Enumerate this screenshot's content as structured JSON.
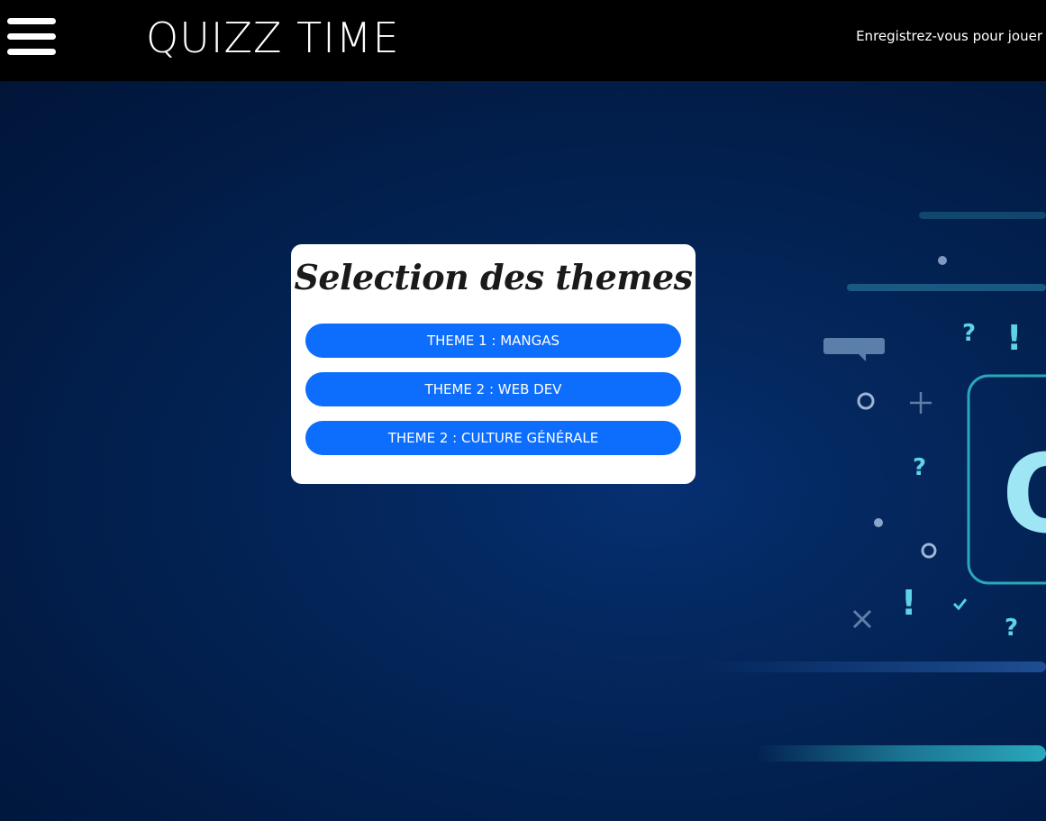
{
  "header": {
    "menu_icon": "hamburger-menu-icon",
    "title": "QUIZZ TIME",
    "register_link": "Enregistrez-vous pour jouer"
  },
  "selection": {
    "title": "Selection des themes",
    "themes": [
      {
        "label": "THEME 1 : MANGAS"
      },
      {
        "label": "THEME 2 : WEB DEV"
      },
      {
        "label": "THEME 2 : CULTURE GÉNÉRALE"
      }
    ]
  },
  "background": {
    "glyphs": [
      "?",
      "!",
      "?",
      "!",
      "?",
      "?"
    ],
    "big_letter": "Q"
  },
  "colors": {
    "topbar": "#000000",
    "button": "#0d6efd",
    "card": "#ffffff",
    "hero_accent": "#5fd3e6"
  }
}
